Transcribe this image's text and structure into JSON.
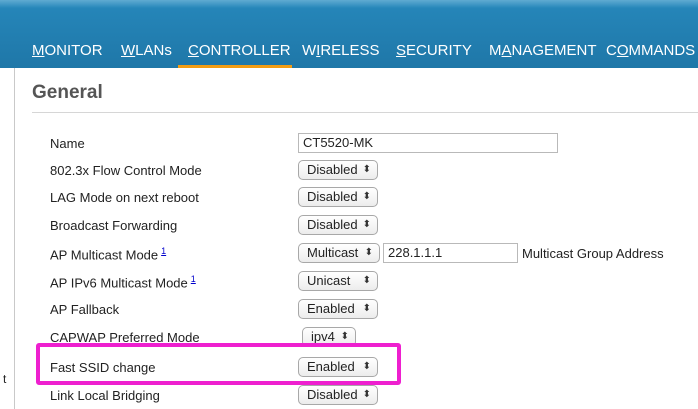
{
  "nav": {
    "items": [
      {
        "pre": "",
        "ul": "M",
        "post": "ONITOR"
      },
      {
        "pre": "",
        "ul": "W",
        "post": "LANs"
      },
      {
        "pre": "",
        "ul": "C",
        "post": "ONTROLLER"
      },
      {
        "pre": "W",
        "ul": "I",
        "post": "RELESS"
      },
      {
        "pre": "",
        "ul": "S",
        "post": "ECURITY"
      },
      {
        "pre": "M",
        "ul": "A",
        "post": "NAGEMENT"
      },
      {
        "pre": "C",
        "ul": "O",
        "post": "MMANDS"
      }
    ],
    "active": "CONTROLLER",
    "active_color": "#f39c12"
  },
  "page": {
    "title": "General"
  },
  "form": {
    "rows": [
      {
        "label": "Name",
        "value": "CT5520-MK"
      },
      {
        "label": "802.3x Flow Control Mode",
        "value": "Disabled"
      },
      {
        "label": "LAG Mode on next reboot",
        "value": "Disabled"
      },
      {
        "label": "Broadcast Forwarding",
        "value": "Disabled"
      },
      {
        "label": "AP Multicast Mode",
        "footnote": "1",
        "value": "Multicast",
        "extra_value": "228.1.1.1",
        "extra_label": "Multicast Group Address"
      },
      {
        "label": "AP IPv6 Multicast Mode",
        "footnote": "1",
        "value": "Unicast"
      },
      {
        "label": "AP Fallback",
        "value": "Enabled"
      },
      {
        "label": "CAPWAP Preferred Mode",
        "value": "ipv4"
      },
      {
        "label": "Fast SSID change",
        "value": "Enabled"
      },
      {
        "label": "Link Local Bridging",
        "value": "Disabled"
      }
    ]
  },
  "select_arrow_glyph": "⬍",
  "edge_fragment": "t",
  "highlight": {
    "row": "Fast SSID change",
    "color": "#ee1fcf"
  },
  "colors": {
    "header": "#1f77a8",
    "accent": "#f39c12",
    "highlight": "#ee1fcf"
  }
}
